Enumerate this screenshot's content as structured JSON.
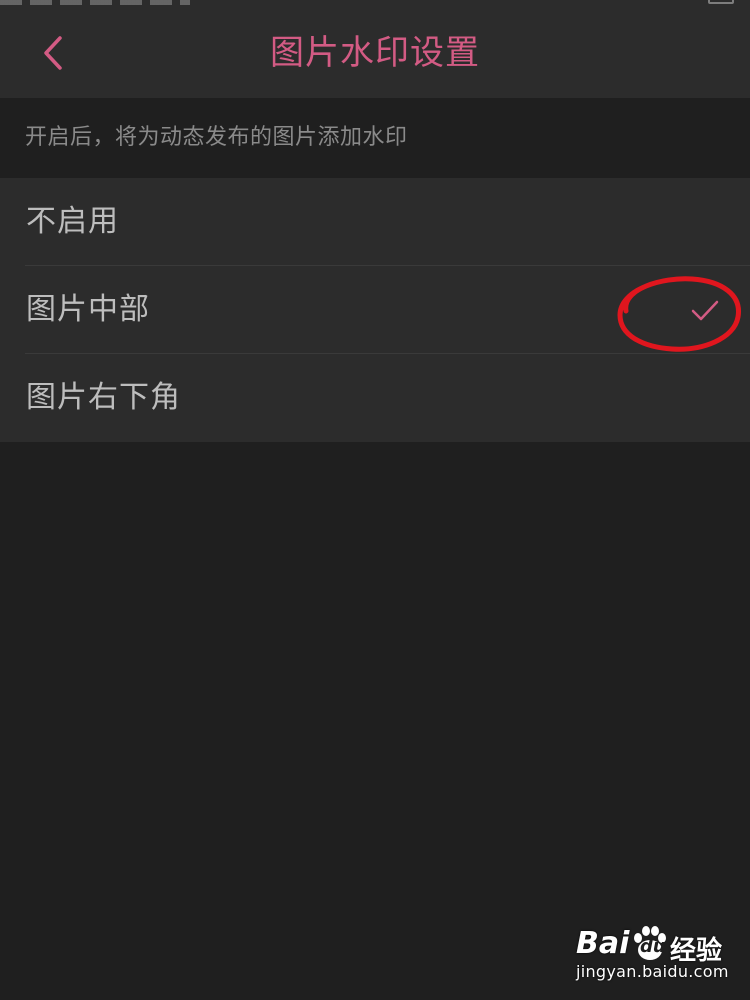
{
  "nav": {
    "title": "图片水印设置",
    "back_icon": "chevron-left-icon"
  },
  "hint": {
    "text": "开启后，将为动态发布的图片添加水印"
  },
  "options": [
    {
      "label": "不启用",
      "selected": false
    },
    {
      "label": "图片中部",
      "selected": true
    },
    {
      "label": "图片右下角",
      "selected": false
    }
  ],
  "selected_icon": "check-icon",
  "annotation": {
    "shape": "circle-annotation",
    "color": "#e0161e"
  },
  "watermark": {
    "brand_left": "Bai",
    "brand_paw_text": "du",
    "brand_right": "经验",
    "url": "jingyan.baidu.com"
  },
  "colors": {
    "accent": "#d35b84",
    "background": "#1f1f1f",
    "panel": "#2c2c2c",
    "text": "#bdbdbd",
    "hint_text": "#8a8a8a"
  }
}
